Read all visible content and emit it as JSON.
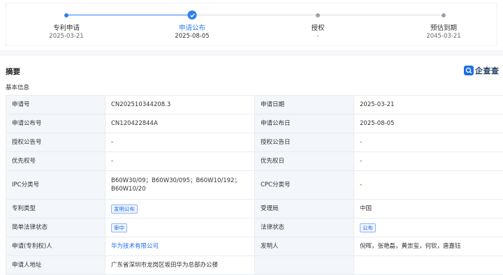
{
  "timeline": {
    "steps": [
      {
        "label": "专利申请",
        "date": "2025-03-21",
        "state": "done"
      },
      {
        "label": "申请公布",
        "date": "2025-08-05",
        "state": "current"
      },
      {
        "label": "授权",
        "date": "-",
        "state": "pending"
      },
      {
        "label": "预估到期",
        "date": "2045-03-21",
        "state": "pending"
      }
    ],
    "colors": {
      "done": "#2f7ff2",
      "pending": "#9aa2ad"
    }
  },
  "section": {
    "title": "摘要",
    "subtitle": "基本信息"
  },
  "logo": {
    "text": "企查查",
    "mark_icon": "search-q-icon"
  },
  "info": {
    "rows": [
      {
        "l1": "申请号",
        "v1": "CN202510344208.3",
        "l2": "申请日期",
        "v2": "2025-03-21"
      },
      {
        "l1": "申请公布号",
        "v1": "CN120422844A",
        "l2": "申请公布日",
        "v2": "2025-08-05"
      },
      {
        "l1": "授权公告号",
        "v1": "-",
        "l2": "授权公告日",
        "v2": "-"
      },
      {
        "l1": "优先权号",
        "v1": "-",
        "l2": "优先权日",
        "v2": "-"
      },
      {
        "l1": "IPC分类号",
        "v1": "B60W30/09；B60W30/095；B60W10/192；B60W10/20",
        "l2": "CPC分类号",
        "v2": "-"
      },
      {
        "l1": "专利类型",
        "v1": "发明公布",
        "l2": "受理局",
        "v2": "中国"
      },
      {
        "l1": "简单法律状态",
        "v1": "审中",
        "l2": "法律状态",
        "v2": "公布"
      },
      {
        "l1": "申请(专利权)人",
        "v1": "华为技术有限公司",
        "l2": "发明人",
        "v2": "倪晖，张艳磊，黄崇玺，何钦，唐嘉钰"
      },
      {
        "l1": "申请人地址",
        "v1": "广东省深圳市龙岗区坂田华为总部办公楼",
        "l2": "",
        "v2": ""
      }
    ]
  }
}
